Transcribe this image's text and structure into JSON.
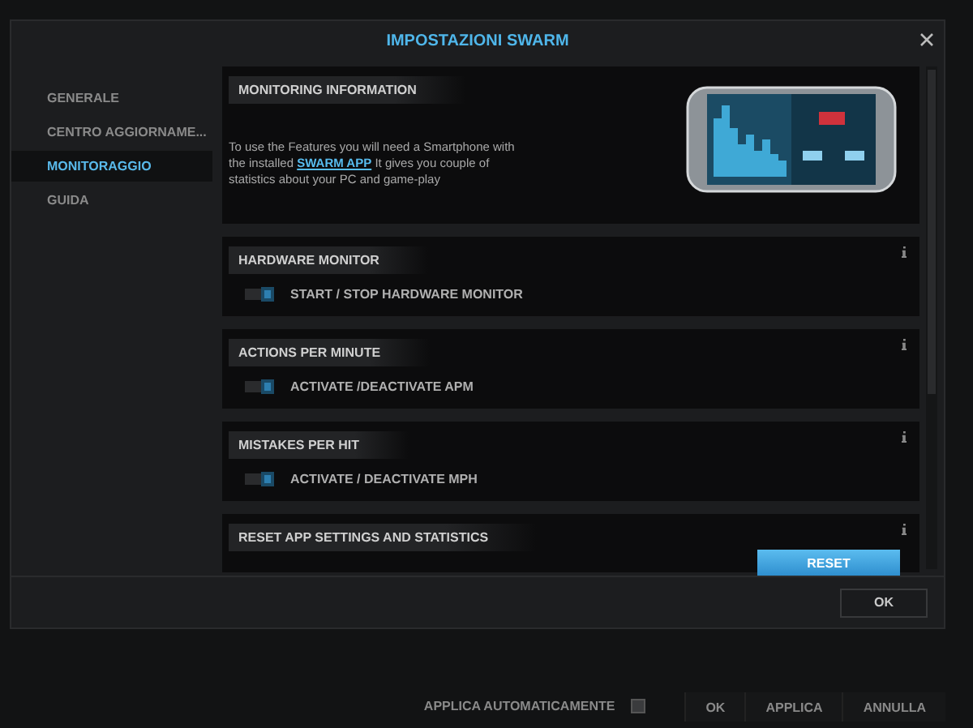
{
  "dialog": {
    "title": "IMPOSTAZIONI SWARM"
  },
  "sidebar": {
    "items": [
      {
        "label": "GENERALE",
        "selected": false
      },
      {
        "label": "CENTRO AGGIORNAME...",
        "selected": false
      },
      {
        "label": "MONITORAGGIO",
        "selected": true
      },
      {
        "label": "GUIDA",
        "selected": false
      }
    ]
  },
  "info_section": {
    "heading": "MONITORING INFORMATION",
    "text_before": "To use the Features you will need a Smartphone with the installed",
    "link": "SWARM APP",
    "text_after": "It gives you couple of statistics about your PC and game-play"
  },
  "sections": [
    {
      "heading": "HARDWARE MONITOR",
      "toggle_label": "START / STOP HARDWARE MONITOR",
      "on": true
    },
    {
      "heading": "ACTIONS PER MINUTE",
      "toggle_label": "ACTIVATE /DEACTIVATE APM",
      "on": true
    },
    {
      "heading": "MISTAKES PER HIT",
      "toggle_label": "ACTIVATE / DEACTIVATE MPH",
      "on": true
    }
  ],
  "reset_section": {
    "heading": "RESET APP SETTINGS AND STATISTICS",
    "button": "RESET"
  },
  "dialog_button": "OK",
  "bottom_bar": {
    "auto_apply_label": "APPLICA AUTOMATICAMENTE",
    "auto_apply_checked": false,
    "buttons": [
      "OK",
      "APPLICA",
      "ANNULLA"
    ]
  }
}
